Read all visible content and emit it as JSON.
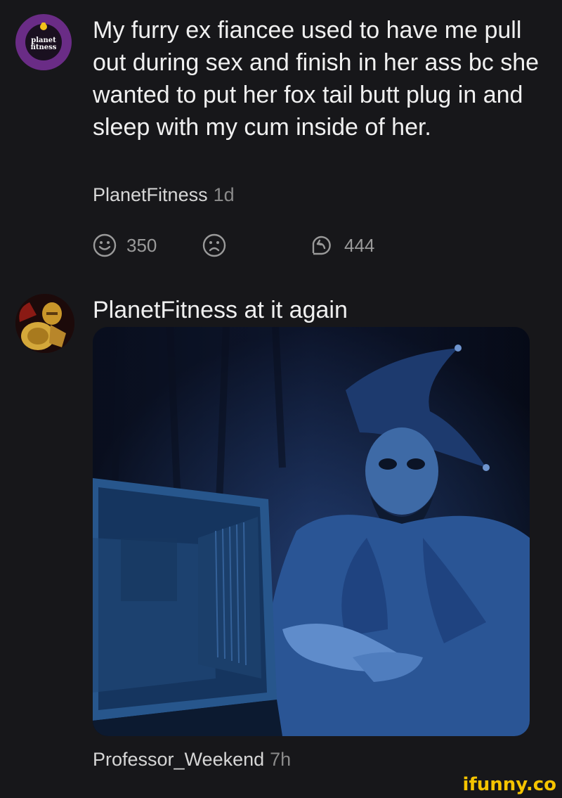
{
  "post1": {
    "avatar_text": "planet fitness",
    "body": "My furry ex fiancee used to have me pull out during sex and finish in her ass bc she wanted to put her fox tail butt plug in and sleep with my cum inside of her.",
    "author": "PlanetFitness",
    "time": "1d",
    "smile_count": "350",
    "reply_count": "444"
  },
  "post2": {
    "title": "PlanetFitness at it again",
    "author": "Professor_Weekend",
    "time": "7h"
  },
  "icons": {
    "smile": "smile-face-icon",
    "frown": "frown-face-icon",
    "reply": "reply-arrow-icon"
  },
  "watermark": "ifunny.co"
}
